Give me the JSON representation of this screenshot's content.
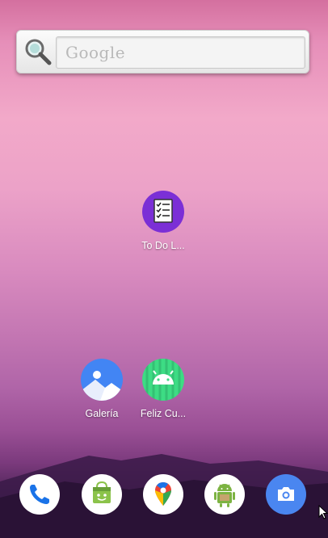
{
  "search_widget": {
    "placeholder": "Google"
  },
  "home_apps": [
    {
      "label": "To Do L...",
      "icon": "checklist-icon",
      "color": "#7b2fd6"
    },
    {
      "label": "Galería",
      "icon": "gallery-icon",
      "color": "#4285f4"
    },
    {
      "label": "Feliz Cu...",
      "icon": "android-icon",
      "color": "#3ddc84"
    }
  ],
  "dock_apps": [
    {
      "icon": "phone-icon"
    },
    {
      "icon": "android-store-icon"
    },
    {
      "icon": "maps-icon"
    },
    {
      "icon": "android-robot-icon"
    },
    {
      "icon": "camera-icon"
    }
  ]
}
